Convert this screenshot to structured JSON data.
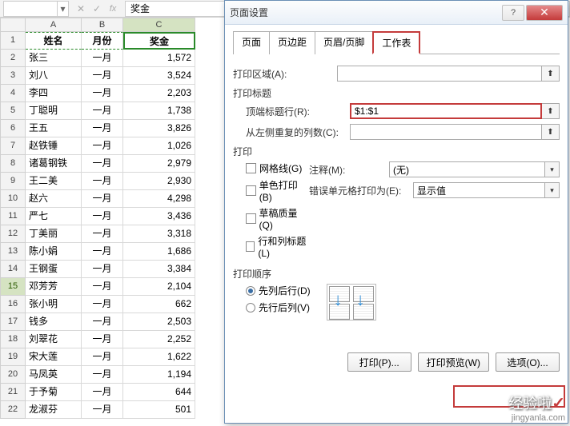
{
  "formula_bar": {
    "name_box": "",
    "fx_label": "fx",
    "formula_value": "奖金"
  },
  "columns": [
    "A",
    "B",
    "C"
  ],
  "headers": {
    "A": "姓名",
    "B": "月份",
    "C": "奖金"
  },
  "rows": [
    {
      "n": 1,
      "A": "姓名",
      "B": "月份",
      "C": "奖金"
    },
    {
      "n": 2,
      "A": "张三",
      "B": "一月",
      "C": "1,572"
    },
    {
      "n": 3,
      "A": "刘八",
      "B": "一月",
      "C": "3,524"
    },
    {
      "n": 4,
      "A": "李四",
      "B": "一月",
      "C": "2,203"
    },
    {
      "n": 5,
      "A": "丁聪明",
      "B": "一月",
      "C": "1,738"
    },
    {
      "n": 6,
      "A": "王五",
      "B": "一月",
      "C": "3,826"
    },
    {
      "n": 7,
      "A": "赵铁锤",
      "B": "一月",
      "C": "1,026"
    },
    {
      "n": 8,
      "A": "诸葛钢铁",
      "B": "一月",
      "C": "2,979"
    },
    {
      "n": 9,
      "A": "王二美",
      "B": "一月",
      "C": "2,930"
    },
    {
      "n": 10,
      "A": "赵六",
      "B": "一月",
      "C": "4,298"
    },
    {
      "n": 11,
      "A": "严七",
      "B": "一月",
      "C": "3,436"
    },
    {
      "n": 12,
      "A": "丁美丽",
      "B": "一月",
      "C": "3,318"
    },
    {
      "n": 13,
      "A": "陈小娟",
      "B": "一月",
      "C": "1,686"
    },
    {
      "n": 14,
      "A": "王钢蛋",
      "B": "一月",
      "C": "3,384"
    },
    {
      "n": 15,
      "A": "邓芳芳",
      "B": "一月",
      "C": "2,104"
    },
    {
      "n": 16,
      "A": "张小明",
      "B": "一月",
      "C": "662"
    },
    {
      "n": 17,
      "A": "钱多",
      "B": "一月",
      "C": "2,503"
    },
    {
      "n": 18,
      "A": "刘翠花",
      "B": "一月",
      "C": "2,252"
    },
    {
      "n": 19,
      "A": "宋大莲",
      "B": "一月",
      "C": "1,622"
    },
    {
      "n": 20,
      "A": "马凤英",
      "B": "一月",
      "C": "1,194"
    },
    {
      "n": 21,
      "A": "于予菊",
      "B": "一月",
      "C": "644"
    },
    {
      "n": 22,
      "A": "龙淑芬",
      "B": "一月",
      "C": "501"
    }
  ],
  "selected_row": 15,
  "dialog": {
    "title": "页面设置",
    "help_glyph": "?",
    "close_glyph": "✕",
    "tabs": {
      "page": "页面",
      "margins": "页边距",
      "headerfooter": "页眉/页脚",
      "sheet": "工作表"
    },
    "active_tab": "sheet",
    "print_area_label": "打印区域(A):",
    "print_area_value": "",
    "print_titles_label": "打印标题",
    "top_row_label": "顶端标题行(R):",
    "top_row_value": "$1:$1",
    "left_col_label": "从左侧重复的列数(C):",
    "left_col_value": "",
    "print_section_label": "打印",
    "gridlines_label": "网格线(G)",
    "bw_label": "单色打印(B)",
    "draft_label": "草稿质量(Q)",
    "rowcol_label": "行和列标题(L)",
    "comments_label": "注释(M):",
    "comments_value": "(无)",
    "errors_label": "错误单元格打印为(E):",
    "errors_value": "显示值",
    "order_label": "打印顺序",
    "order_down_label": "先列后行(D)",
    "order_over_label": "先行后列(V)",
    "btn_print": "打印(P)...",
    "btn_preview": "打印预览(W)",
    "btn_options": "选项(O)...",
    "range_glyph": "⬆"
  },
  "watermark": {
    "main": "经验啦",
    "check": "✓",
    "url": "jingyanla.com"
  }
}
